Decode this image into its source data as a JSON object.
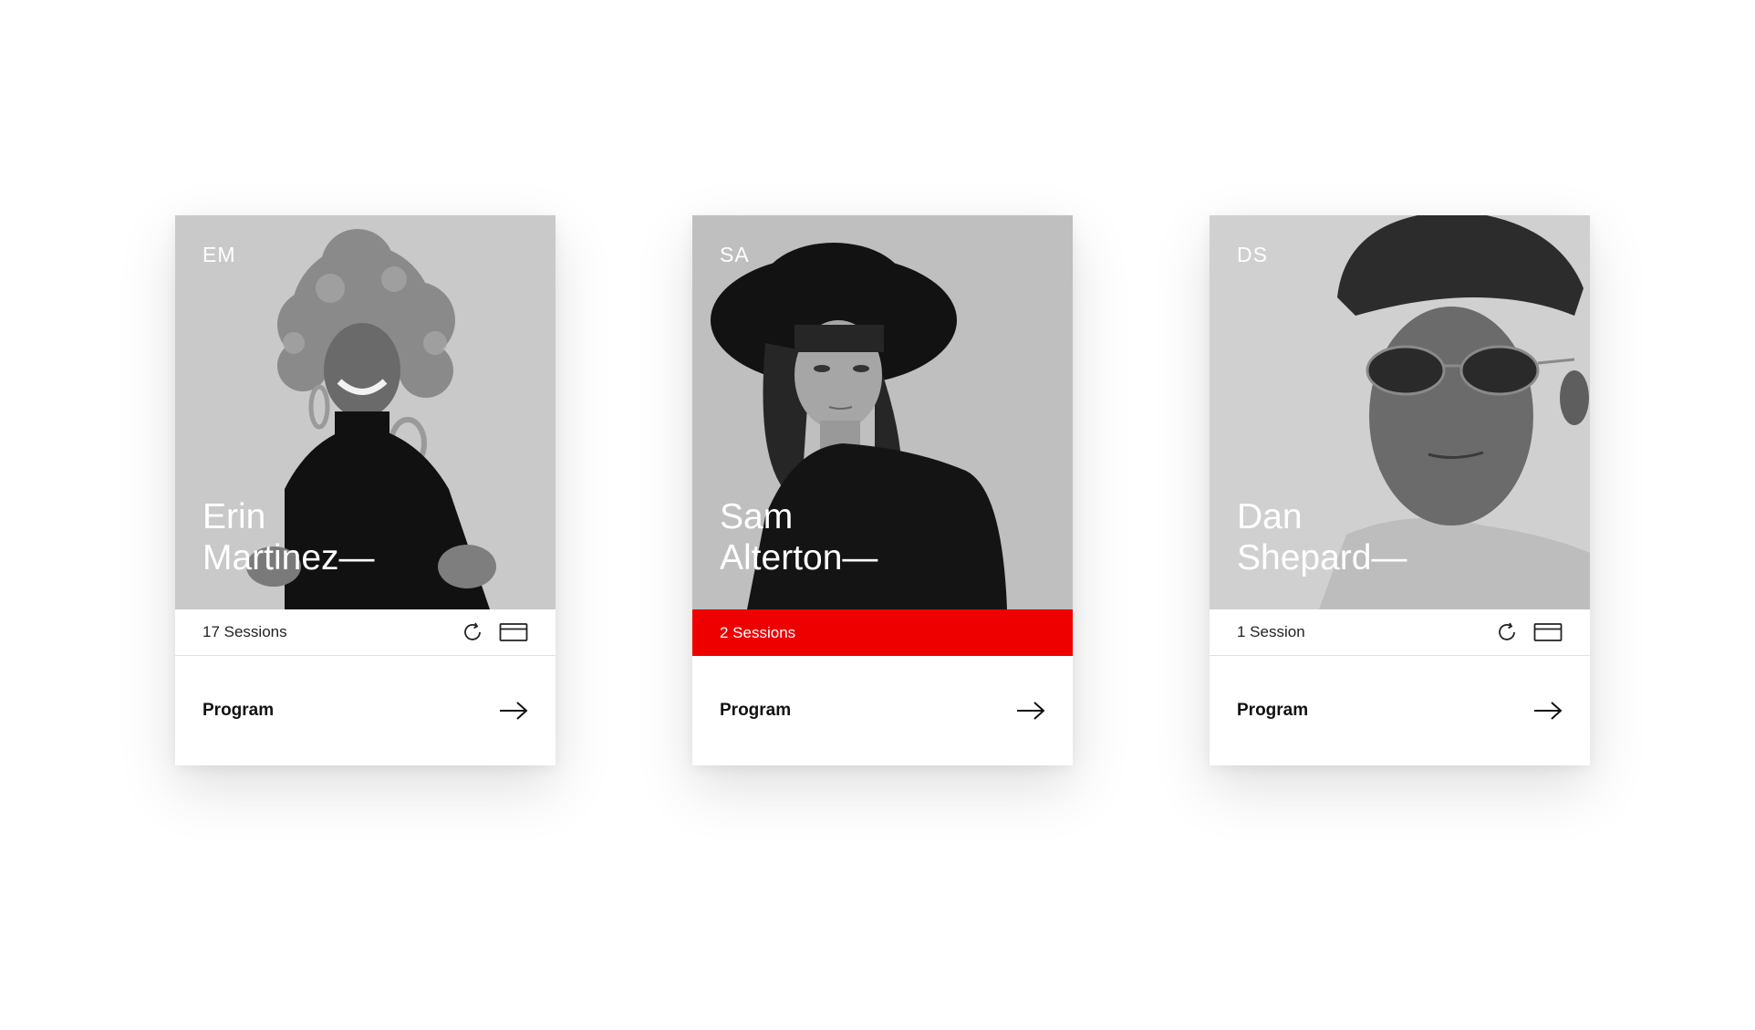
{
  "cards": [
    {
      "initials": "EM",
      "first_name": "Erin",
      "last_name": "Martinez—",
      "sessions": "17 Sessions",
      "sessions_highlighted": false,
      "program_label": "Program",
      "icons": [
        "refresh-icon",
        "card-icon",
        "arrow-right-icon"
      ]
    },
    {
      "initials": "SA",
      "first_name": "Sam",
      "last_name": "Alterton—",
      "sessions": "2 Sessions",
      "sessions_highlighted": true,
      "program_label": "Program",
      "icons": [
        "arrow-right-icon"
      ]
    },
    {
      "initials": "DS",
      "first_name": "Dan",
      "last_name": "Shepard—",
      "sessions": "1 Session",
      "sessions_highlighted": false,
      "program_label": "Program",
      "icons": [
        "refresh-icon",
        "card-icon",
        "arrow-right-icon"
      ]
    }
  ],
  "colors": {
    "accent": "#ee0000",
    "photo_background": "#c7c7c7",
    "text": "#111111"
  }
}
